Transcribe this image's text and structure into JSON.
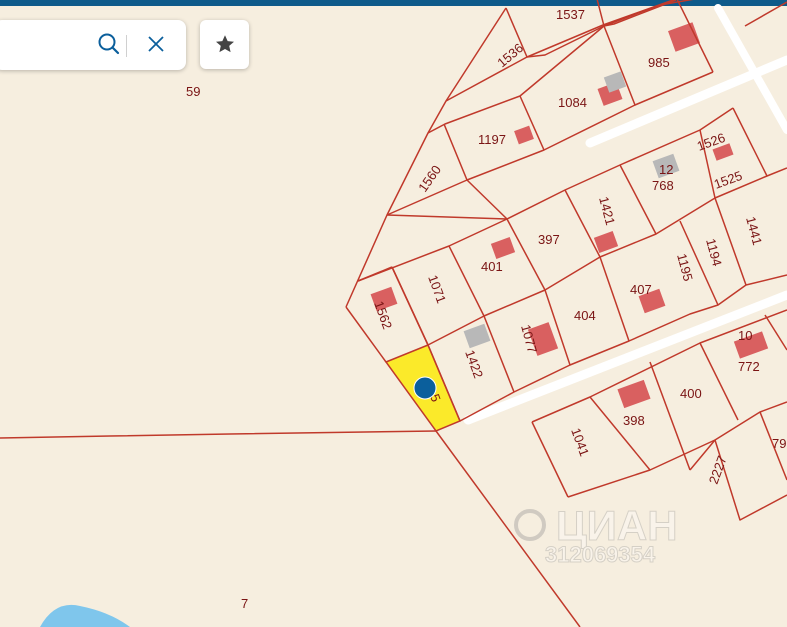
{
  "colors": {
    "background": "#f6eedf",
    "parcel_line": "#c0392b",
    "highlight": "#fbea2a",
    "building": "#d96060",
    "marker": "#0b5f9c",
    "water": "#7fc6ec",
    "road": "#ffffff",
    "accent": "#0e5a8a"
  },
  "search": {
    "value": "",
    "search_icon": "search-icon",
    "clear_icon": "close-icon"
  },
  "favorite": {
    "icon": "star-icon"
  },
  "parcel_labels": {
    "p59": "59",
    "p7": "7",
    "p1537": "1537",
    "p1536": "1536",
    "p985": "985",
    "p1084": "1084",
    "p1197": "1197",
    "p1560": "1560",
    "p1526": "1526",
    "p12": "12",
    "p768": "768",
    "p1525": "1525",
    "p1421": "1421",
    "p397": "397",
    "p401": "401",
    "p1071": "1071",
    "p1441": "1441",
    "p1194": "1194",
    "p1195": "1195",
    "p407": "407",
    "p404": "404",
    "p1562": "1562",
    "p1077": "1077",
    "p1422": "1422",
    "p5": "5",
    "p10": "10",
    "p772": "772",
    "p400": "400",
    "p398": "398",
    "p1041": "1041",
    "p2227": "2227",
    "p79": "79"
  },
  "watermark": {
    "brand": "ЦИАН",
    "number": "312069354"
  }
}
